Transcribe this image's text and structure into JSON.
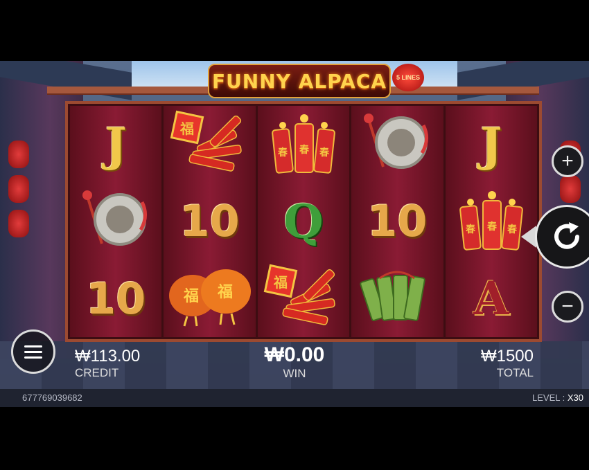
{
  "game": {
    "title": "FUNNY ALPACA",
    "lines_badge": "5 LINES"
  },
  "reels": [
    [
      {
        "type": "letter",
        "text": "J",
        "style": "gold",
        "name": "j-symbol"
      },
      {
        "type": "icon",
        "icon": "gong-icon",
        "name": "gong-symbol"
      },
      {
        "type": "number",
        "text": "10",
        "name": "ten-symbol"
      }
    ],
    [
      {
        "type": "icon",
        "icon": "firecracker-bundle-icon",
        "name": "firecracker-bundle-symbol"
      },
      {
        "type": "number",
        "text": "10",
        "name": "ten-symbol"
      },
      {
        "type": "icon",
        "icon": "lantern-pair-icon",
        "name": "lantern-symbol"
      }
    ],
    [
      {
        "type": "icon",
        "icon": "firecrackers-icon",
        "name": "firecrackers-symbol"
      },
      {
        "type": "letter",
        "text": "Q",
        "style": "green",
        "name": "q-symbol"
      },
      {
        "type": "icon",
        "icon": "firecracker-bundle-icon",
        "name": "firecracker-bundle-symbol"
      }
    ],
    [
      {
        "type": "icon",
        "icon": "gong-icon",
        "name": "gong-symbol"
      },
      {
        "type": "number",
        "text": "10",
        "name": "ten-symbol"
      },
      {
        "type": "icon",
        "icon": "jade-tablets-icon",
        "name": "jade-symbol"
      }
    ],
    [
      {
        "type": "letter",
        "text": "J",
        "style": "gold",
        "name": "j-symbol"
      },
      {
        "type": "icon",
        "icon": "firecrackers-icon",
        "name": "firecrackers-symbol"
      },
      {
        "type": "letter",
        "text": "A",
        "style": "red",
        "name": "a-symbol"
      }
    ]
  ],
  "stats": {
    "credit_amount": "₩113.00",
    "credit_label": "CREDIT",
    "win_amount": "₩0.00",
    "win_label": "WIN",
    "total_amount": "₩1500",
    "total_label": "TOTAL"
  },
  "info": {
    "session_id": "677769039682",
    "level_label": "LEVEL :",
    "level_value": "X30"
  },
  "controls": {
    "plus_icon": "plus-icon",
    "minus_icon": "minus-icon",
    "spin_icon": "spin-arrow-icon",
    "menu_icon": "hamburger-menu-icon"
  }
}
